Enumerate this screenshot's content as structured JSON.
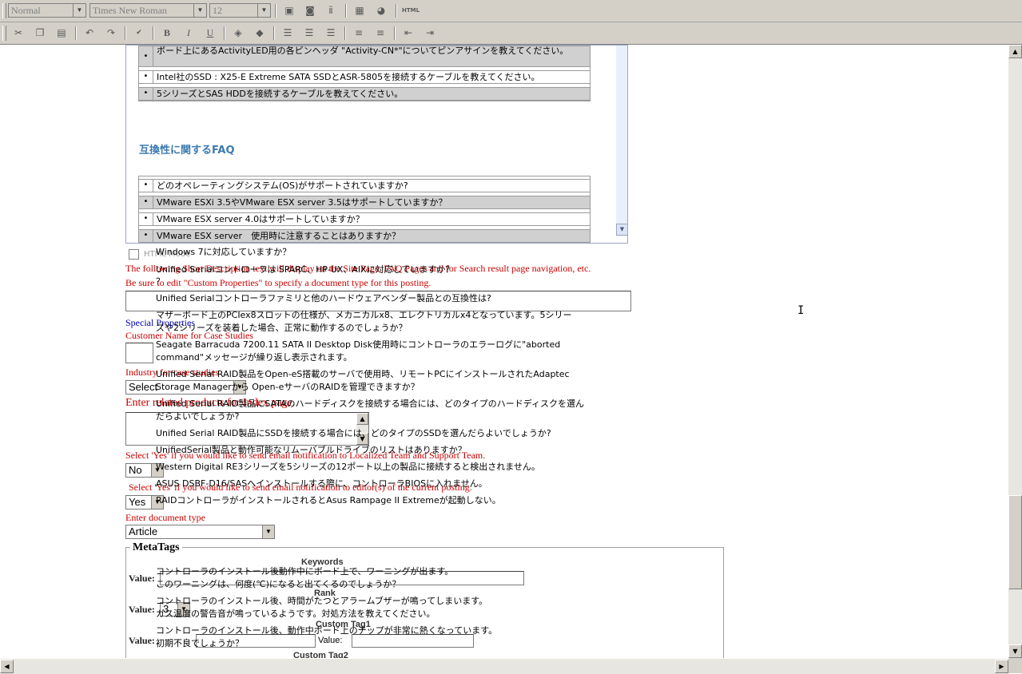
{
  "toolbar": {
    "style_value": "Normal",
    "font_value": "Times New Roman",
    "size_value": "12",
    "html_label": "HTML",
    "bold": "B",
    "italic": "I",
    "underline": "U"
  },
  "frame": {
    "rows_top": [
      "ボード上にあるActivityLED用の各ピンヘッダ \"Activity-CN*\"についてピンアサインを教えてください。",
      "Intel社のSSD : X25-E Extreme SATA SSDとASR-5805を接続するケーブルを教えてください。",
      "5シリーズとSAS HDDを接続するケーブルを教えてください。"
    ],
    "heading": "互換性に関するFAQ",
    "rows_bottom": [
      "どのオペレーティングシステム(OS)がサポートされていますか?",
      "VMware ESXi 3.5やVMware ESX server 3.5はサポートしていますか？",
      "VMware ESX server 4.0はサポートしていますか？",
      "VMware ESX server　使用時に注意することはありますか？"
    ],
    "bullet": "•"
  },
  "html_mode_label": "HTML Mode",
  "overlay": [
    "Windows 7に対応していますか？",
    "Unified Serialコントローラは SPARC、HP-UX、AIXに対応していますか？",
    "？",
    "Unified Serialコントローラファミリと他のハードウェアベンダー製品との互換性は?",
    "マザーボード上のPCIex8スロットの仕様が、メカニカルx8、エレクトリカルx4となっています。5シリー",
    "ズや2シリーズを装着した場合、正常に動作するのでしょうか？",
    "Seagate Barracuda 7200.11 SATA II Desktop Disk使用時にコントローラのエラーログに\"aborted",
    "command\"メッセージが繰り返し表示されます。",
    "Unified Serial RAID製品をOpen-eS搭載のサーバで使用時、リモートPCにインストールされたAdaptec",
    "Storage Managerから Open-eサーバのRAIDを管理できますか？",
    "Unified Serial RAID製品にSATAのハードディスクを接続する場合には、どのタイプのハードディスクを選ん",
    "だらよいでしょうか?",
    "Unified Serial RAID製品にSSDを接続する場合には、どのタイプのSSDを選んだらよいでしょうか?",
    "UnifiedSerial製品と動作可能なリムーバブルドライブのリストはありますか？",
    "Western Digital RE3シリーズを5シリーズの12ポート以上の製品に接続すると検出されません。",
    "ASUS DSBF-D16/SASへインストールする際に、コントローラBIOSに入れません。",
    "RAIDコントローラがインストールされるとAsus Rampage II Extremeが起動しない。",
    "コントローラのインストール後動作中にボード上で、ワーニングが出ます。",
    "このワーニングは、何度(℃)になると出てくるのでしょうか？",
    "コントローラのインストール後、時間がたつとアラームブザーが鳴ってしまいます。",
    "ガス温度の警告音が鳴っているようです。対処方法を教えてください。",
    "コントローラのインストール後、動作中ボード上のチップが非常に熱くなっています。",
    "初期不良でしょうか？"
  ],
  "form": {
    "desc_label": "The following Short Description text will display on the Site Page, FAQ Pages and for Search result page navigation, etc.",
    "edit_note": "Be sure to edit \"Custom Properties\" to specify a document type for this posting.",
    "special_properties": "Special Properties",
    "customer_name_label": "Customer Name for Case Studies",
    "industry_label": "Industry for case studies",
    "industry_value": "Select",
    "related_label": "Enter related products for Index page.",
    "localized_label": "Select 'Yes' if you would like to send email notification to Localized Team and Support Team.",
    "localized_value": "No",
    "editor_label": "Select 'Yes' if you would like to send email notification to editor(s) of the current posting.",
    "editor_value": "Yes",
    "doc_type_label": "Enter document type",
    "doc_type_value": "Article"
  },
  "metatags": {
    "legend": "MetaTags",
    "keywords_caption": "Keywords",
    "rank_caption": "Rank",
    "custom_tag1_caption": "Custom Tag1",
    "custom_tag2_caption": "Custom Tag2",
    "value_label": "Value:",
    "rank_value": "3"
  }
}
